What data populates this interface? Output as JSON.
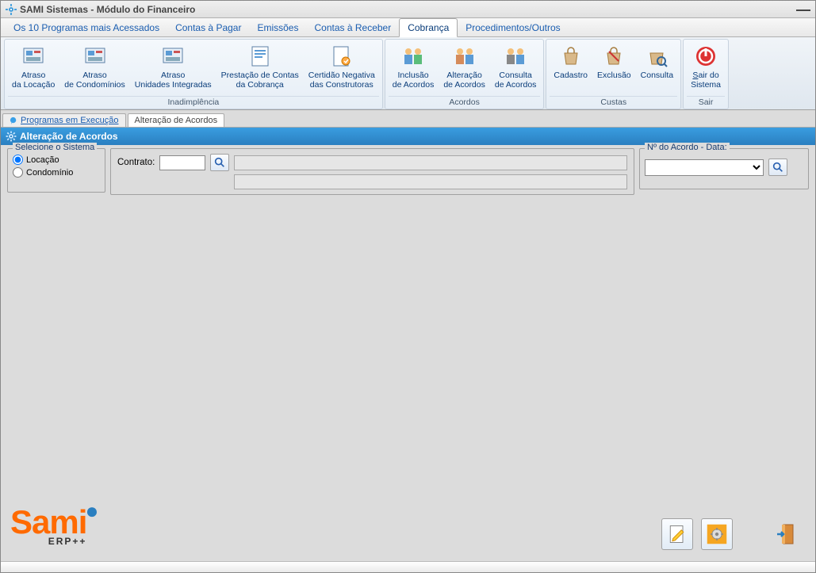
{
  "window": {
    "title": "SAMI Sistemas - Módulo do Financeiro"
  },
  "menu": {
    "items": [
      "Os 10 Programas mais Acessados",
      "Contas à Pagar",
      "Emissões",
      "Contas à Receber",
      "Cobrança",
      "Procedimentos/Outros"
    ],
    "active_index": 4
  },
  "ribbon": {
    "groups": [
      {
        "label": "Inadimplência",
        "buttons": [
          {
            "line1": "Atraso",
            "line2": "da Locação"
          },
          {
            "line1": "Atraso",
            "line2": "de Condomínios"
          },
          {
            "line1": "Atraso",
            "line2": "Unidades Integradas"
          },
          {
            "line1": "Prestação de Contas",
            "line2": "da Cobrança"
          },
          {
            "line1": "Certidão Negativa",
            "line2": "das Construtoras"
          }
        ]
      },
      {
        "label": "Acordos",
        "buttons": [
          {
            "line1": "Inclusão",
            "line2": "de Acordos"
          },
          {
            "line1": "Alteração",
            "line2": "de Acordos"
          },
          {
            "line1": "Consulta",
            "line2": "de Acordos"
          }
        ]
      },
      {
        "label": "Custas",
        "buttons": [
          {
            "line1": "Cadastro",
            "line2": ""
          },
          {
            "line1": "Exclusão",
            "line2": ""
          },
          {
            "line1": "Consulta",
            "line2": ""
          }
        ]
      },
      {
        "label": "Sair",
        "buttons": [
          {
            "line1": "Sair do",
            "line2": "Sistema",
            "accessor_first": "S"
          }
        ]
      }
    ]
  },
  "docTabs": {
    "tabs": [
      {
        "label": "Programas em Execução",
        "link_style": true
      },
      {
        "label": "Alteração de Acordos",
        "link_style": false
      }
    ],
    "active_index": 1
  },
  "page": {
    "title": "Alteração de Acordos"
  },
  "form": {
    "systemGroup": {
      "legend": "Selecione o Sistema",
      "options": [
        "Locação",
        "Condomínio"
      ],
      "selected_index": 0
    },
    "contract": {
      "label": "Contrato:",
      "value": "",
      "display1": "",
      "display2": ""
    },
    "acordo": {
      "legend": "Nº do Acordo - Data:",
      "selected": ""
    }
  },
  "logo": {
    "text": "Sami",
    "sub": "ERP++"
  }
}
